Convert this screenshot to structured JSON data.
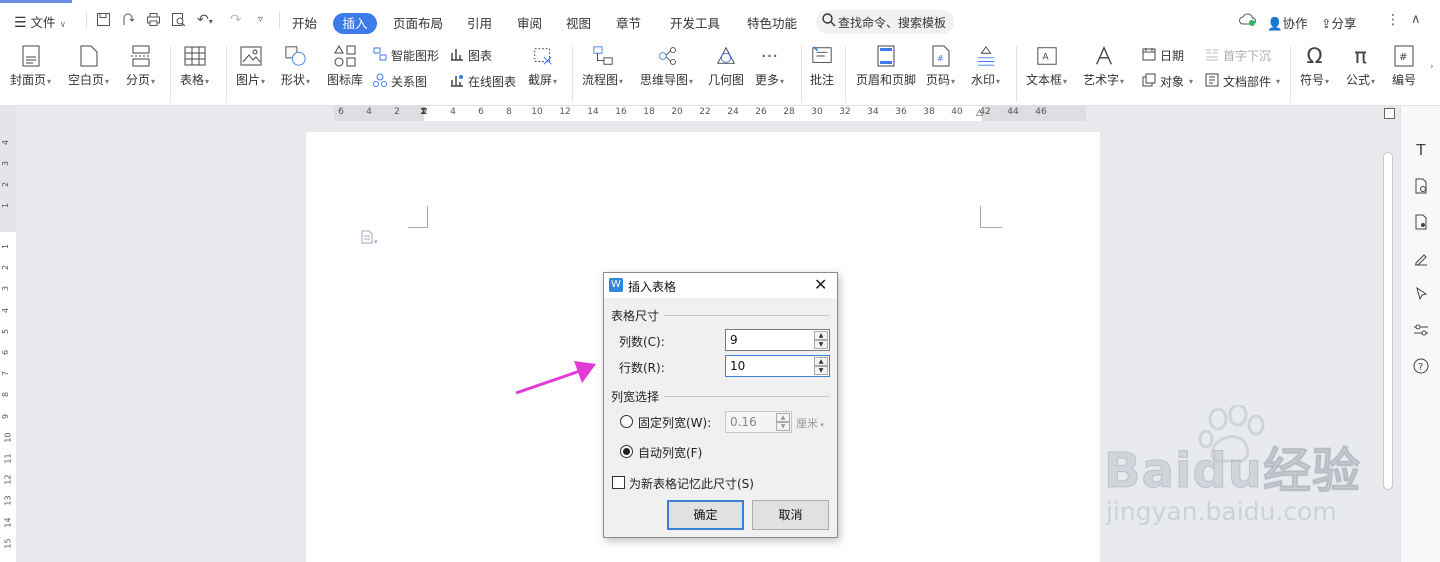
{
  "menubar": {
    "file_label": "文件",
    "tabs": [
      {
        "label": "开始"
      },
      {
        "label": "插入"
      },
      {
        "label": "页面布局"
      },
      {
        "label": "引用"
      },
      {
        "label": "审阅"
      },
      {
        "label": "视图"
      },
      {
        "label": "章节"
      },
      {
        "label": "开发工具"
      },
      {
        "label": "特色功能"
      }
    ],
    "search_placeholder": "查找命令、搜索模板",
    "collab_label": "协作",
    "share_label": "分享"
  },
  "ribbon": {
    "cover_page": "封面页",
    "blank_page": "空白页",
    "page_break": "分页",
    "table": "表格",
    "picture": "图片",
    "shape": "形状",
    "icon_lib": "图标库",
    "smart_art": "智能图形",
    "chart": "图表",
    "relation_chart": "关系图",
    "online_chart": "在线图表",
    "screenshot": "截屏",
    "flowchart": "流程图",
    "mindmap": "思维导图",
    "geometry": "几何图",
    "more": "更多",
    "comment": "批注",
    "header_footer": "页眉和页脚",
    "page_number": "页码",
    "watermark": "水印",
    "textbox": "文本框",
    "wordart": "艺术字",
    "date": "日期",
    "object": "对象",
    "drop_cap": "首字下沉",
    "doc_parts": "文档部件",
    "symbol": "符号",
    "formula": "公式",
    "numbering": "编号"
  },
  "ruler": {
    "h_ticks": [
      "6",
      "4",
      "2",
      "2",
      "4",
      "6",
      "8",
      "10",
      "12",
      "14",
      "16",
      "18",
      "20",
      "22",
      "24",
      "26",
      "28",
      "30",
      "32",
      "34",
      "36",
      "38",
      "40",
      "42",
      "44",
      "46"
    ],
    "v_ticks_top": [
      "4",
      "3",
      "2",
      "1"
    ],
    "v_ticks": [
      "1",
      "2",
      "3",
      "4",
      "5",
      "6",
      "7",
      "8",
      "9",
      "10",
      "11",
      "12",
      "13",
      "14",
      "15"
    ]
  },
  "dialog": {
    "title": "插入表格",
    "size_group": "表格尺寸",
    "columns_label": "列数(C):",
    "columns_value": "9",
    "rows_label": "行数(R):",
    "rows_value": "10",
    "width_group": "列宽选择",
    "fixed_width_label": "固定列宽(W):",
    "fixed_width_value": "0.16",
    "unit": "厘米",
    "auto_width_label": "自动列宽(F)",
    "remember_label": "为新表格记忆此尺寸(S)",
    "ok_label": "确定",
    "cancel_label": "取消"
  },
  "watermark": {
    "brand": "Baidu经验",
    "url": "jingyan.baidu.com"
  },
  "colors": {
    "accent": "#3d7bea",
    "arrow": "#e13ad6",
    "dialog_icon": "#2e86de"
  }
}
